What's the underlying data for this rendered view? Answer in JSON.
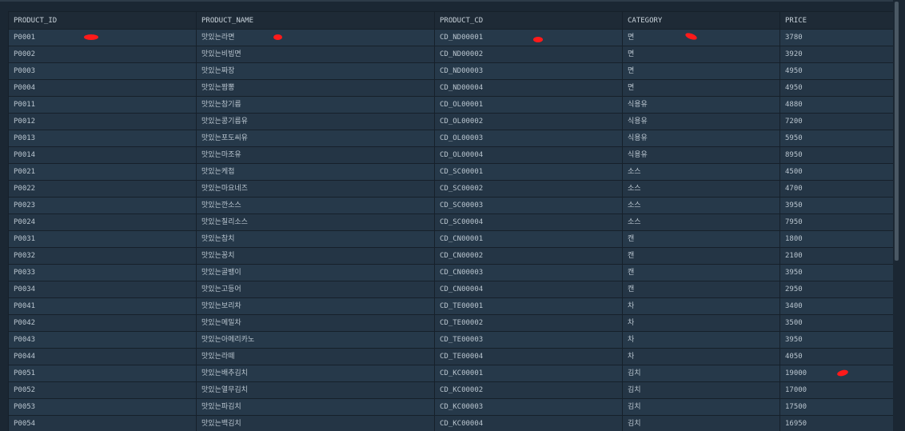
{
  "grid": {
    "headers": [
      "PRODUCT_ID",
      "PRODUCT_NAME",
      "PRODUCT_CD",
      "CATEGORY",
      "PRICE"
    ],
    "rows": [
      [
        "P0001",
        "맛있는라면",
        "CD_ND00001",
        "면",
        "3780"
      ],
      [
        "P0002",
        "맛있는비빔면",
        "CD_ND00002",
        "면",
        "3920"
      ],
      [
        "P0003",
        "맛있는짜장",
        "CD_ND00003",
        "면",
        "4950"
      ],
      [
        "P0004",
        "맛있는짬뽕",
        "CD_ND00004",
        "면",
        "4950"
      ],
      [
        "P0011",
        "맛있는참기름",
        "CD_OL00001",
        "식용유",
        "4880"
      ],
      [
        "P0012",
        "맛있는콩기름유",
        "CD_OL00002",
        "식용유",
        "7200"
      ],
      [
        "P0013",
        "맛있는포도씨유",
        "CD_OL00003",
        "식용유",
        "5950"
      ],
      [
        "P0014",
        "맛있는마조유",
        "CD_OL00004",
        "식용유",
        "8950"
      ],
      [
        "P0021",
        "맛있는케첩",
        "CD_SC00001",
        "소스",
        "4500"
      ],
      [
        "P0022",
        "맛있는마요네즈",
        "CD_SC00002",
        "소스",
        "4700"
      ],
      [
        "P0023",
        "맛있는깐소스",
        "CD_SC00003",
        "소스",
        "3950"
      ],
      [
        "P0024",
        "맛있는칠리소스",
        "CD_SC00004",
        "소스",
        "7950"
      ],
      [
        "P0031",
        "맛있는참치",
        "CD_CN00001",
        "캔",
        "1800"
      ],
      [
        "P0032",
        "맛있는꽁치",
        "CD_CN00002",
        "캔",
        "2100"
      ],
      [
        "P0033",
        "맛있는골뱅이",
        "CD_CN00003",
        "캔",
        "3950"
      ],
      [
        "P0034",
        "맛있는고등어",
        "CD_CN00004",
        "캔",
        "2950"
      ],
      [
        "P0041",
        "맛있는보리차",
        "CD_TE00001",
        "차",
        "3400"
      ],
      [
        "P0042",
        "맛있는메밀차",
        "CD_TE00002",
        "차",
        "3500"
      ],
      [
        "P0043",
        "맛있는아메리카노",
        "CD_TE00003",
        "차",
        "3950"
      ],
      [
        "P0044",
        "맛있는라떼",
        "CD_TE00004",
        "차",
        "4050"
      ],
      [
        "P0051",
        "맛있는배추김치",
        "CD_KC00001",
        "김치",
        "19000"
      ],
      [
        "P0052",
        "맛있는열무김치",
        "CD_KC00002",
        "김치",
        "17000"
      ],
      [
        "P0053",
        "맛있는파김치",
        "CD_KC00003",
        "김치",
        "17500"
      ],
      [
        "P0054",
        "맛있는백김치",
        "CD_KC00004",
        "김치",
        "16950"
      ]
    ]
  },
  "colors": {
    "background": "#1b2733",
    "row": "#26394a",
    "header": "#1e2a36",
    "text": "#b9c5cf",
    "annotation_mark": "#ff1a1a"
  }
}
